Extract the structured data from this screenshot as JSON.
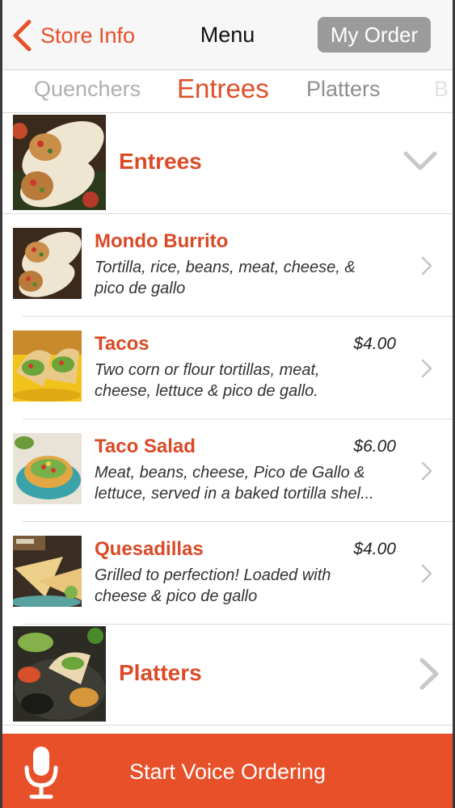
{
  "nav": {
    "back_label": "Store Info",
    "title": "Menu",
    "order_label": "My Order"
  },
  "tabs": [
    "Quenchers",
    "Entrees",
    "Platters",
    "B"
  ],
  "selected_tab": "Entrees",
  "sections": {
    "entrees": {
      "title": "Entrees",
      "indicator": "chevron-down-icon"
    },
    "platters": {
      "title": "Platters",
      "indicator": "chevron-right-icon"
    }
  },
  "items": [
    {
      "name": "Mondo Burrito",
      "price": "",
      "desc_lines": [
        "Tortilla, rice, beans, meat, cheese, &",
        "pico de gallo"
      ]
    },
    {
      "name": "Tacos",
      "price": "$4.00",
      "desc_lines": [
        "Two corn or flour tortillas, meat,",
        "cheese, lettuce & pico de gallo."
      ]
    },
    {
      "name": "Taco Salad",
      "price": "$6.00",
      "desc_lines": [
        "Meat, beans, cheese, Pico de Gallo &",
        "lettuce, served in a baked tortilla shel..."
      ]
    },
    {
      "name": "Quesadillas",
      "price": "$4.00",
      "desc_lines": [
        "Grilled to perfection! Loaded with",
        "cheese & pico de gallo"
      ]
    }
  ],
  "voice": {
    "label": "Start Voice Ordering",
    "icon": "microphone-icon"
  },
  "colors": {
    "accent": "#e8502a",
    "item_title": "#d94a26",
    "order_button": "#9b9b9b"
  }
}
